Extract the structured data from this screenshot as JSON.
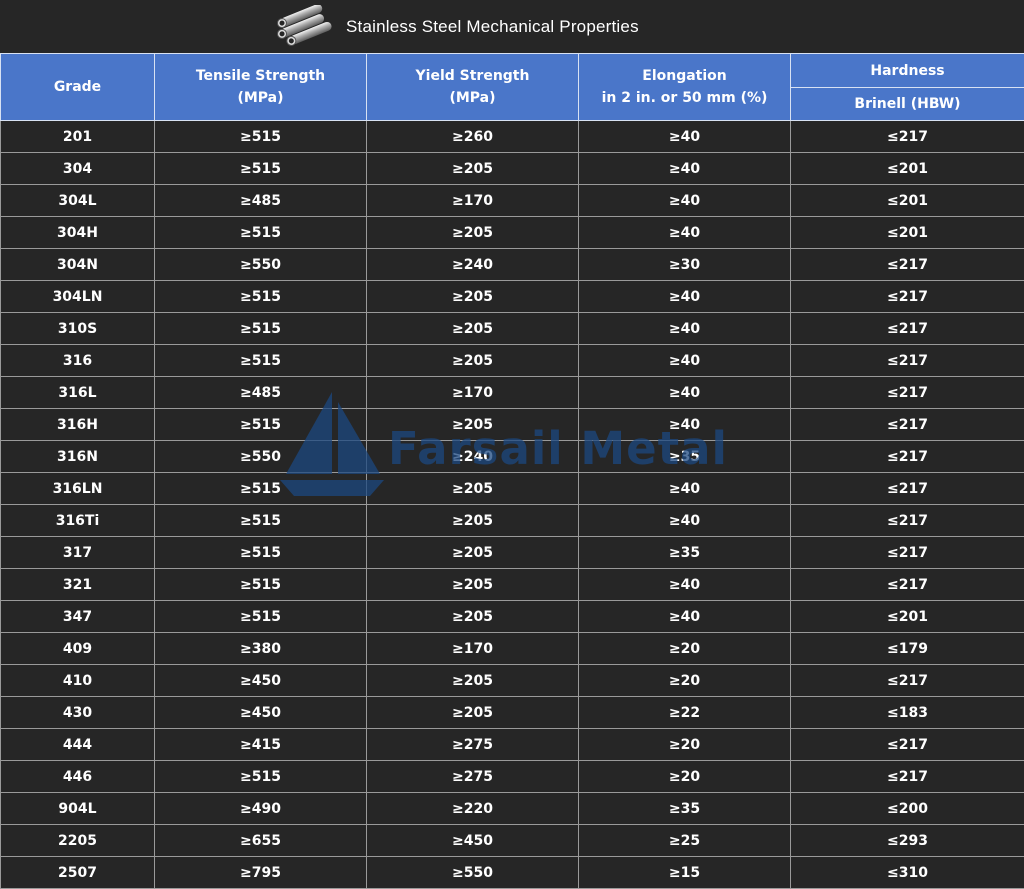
{
  "title": "Stainless Steel  Mechanical Properties",
  "icon": "steel-pipes-icon",
  "watermark": "Farsail Metal",
  "header": {
    "grade": "Grade",
    "tensile": [
      "Tensile Strength",
      "(MPa)"
    ],
    "yield": [
      "Yield Strength",
      "(MPa)"
    ],
    "elongation": [
      "Elongation",
      "in 2 in. or 50 mm (%)"
    ],
    "hardness": "Hardness",
    "brinell": "Brinell  (HBW)"
  },
  "rows": [
    [
      "201",
      "≥515",
      "≥260",
      "≥40",
      "≤217"
    ],
    [
      "304",
      "≥515",
      "≥205",
      "≥40",
      "≤201"
    ],
    [
      "304L",
      "≥485",
      "≥170",
      "≥40",
      "≤201"
    ],
    [
      "304H",
      "≥515",
      "≥205",
      "≥40",
      "≤201"
    ],
    [
      "304N",
      "≥550",
      "≥240",
      "≥30",
      "≤217"
    ],
    [
      "304LN",
      "≥515",
      "≥205",
      "≥40",
      "≤217"
    ],
    [
      "310S",
      "≥515",
      "≥205",
      "≥40",
      "≤217"
    ],
    [
      "316",
      "≥515",
      "≥205",
      "≥40",
      "≤217"
    ],
    [
      "316L",
      "≥485",
      "≥170",
      "≥40",
      "≤217"
    ],
    [
      "316H",
      "≥515",
      "≥205",
      "≥40",
      "≤217"
    ],
    [
      "316N",
      "≥550",
      "≥240",
      "≥35",
      "≤217"
    ],
    [
      "316LN",
      "≥515",
      "≥205",
      "≥40",
      "≤217"
    ],
    [
      "316Ti",
      "≥515",
      "≥205",
      "≥40",
      "≤217"
    ],
    [
      "317",
      "≥515",
      "≥205",
      "≥35",
      "≤217"
    ],
    [
      "321",
      "≥515",
      "≥205",
      "≥40",
      "≤217"
    ],
    [
      "347",
      "≥515",
      "≥205",
      "≥40",
      "≤201"
    ],
    [
      "409",
      "≥380",
      "≥170",
      "≥20",
      "≤179"
    ],
    [
      "410",
      "≥450",
      "≥205",
      "≥20",
      "≤217"
    ],
    [
      "430",
      "≥450",
      "≥205",
      "≥22",
      "≤183"
    ],
    [
      "444",
      "≥415",
      "≥275",
      "≥20",
      "≤217"
    ],
    [
      "446",
      "≥515",
      "≥275",
      "≥20",
      "≤217"
    ],
    [
      "904L",
      "≥490",
      "≥220",
      "≥35",
      "≤200"
    ],
    [
      "2205",
      "≥655",
      "≥450",
      "≥25",
      "≤293"
    ],
    [
      "2507",
      "≥795",
      "≥550",
      "≥15",
      "≤310"
    ]
  ],
  "colors": {
    "header_bg": "#4a76c9",
    "page_bg": "#262626",
    "grid": "#9a9a9a",
    "text": "#ffffff",
    "watermark": "#1c4880"
  }
}
